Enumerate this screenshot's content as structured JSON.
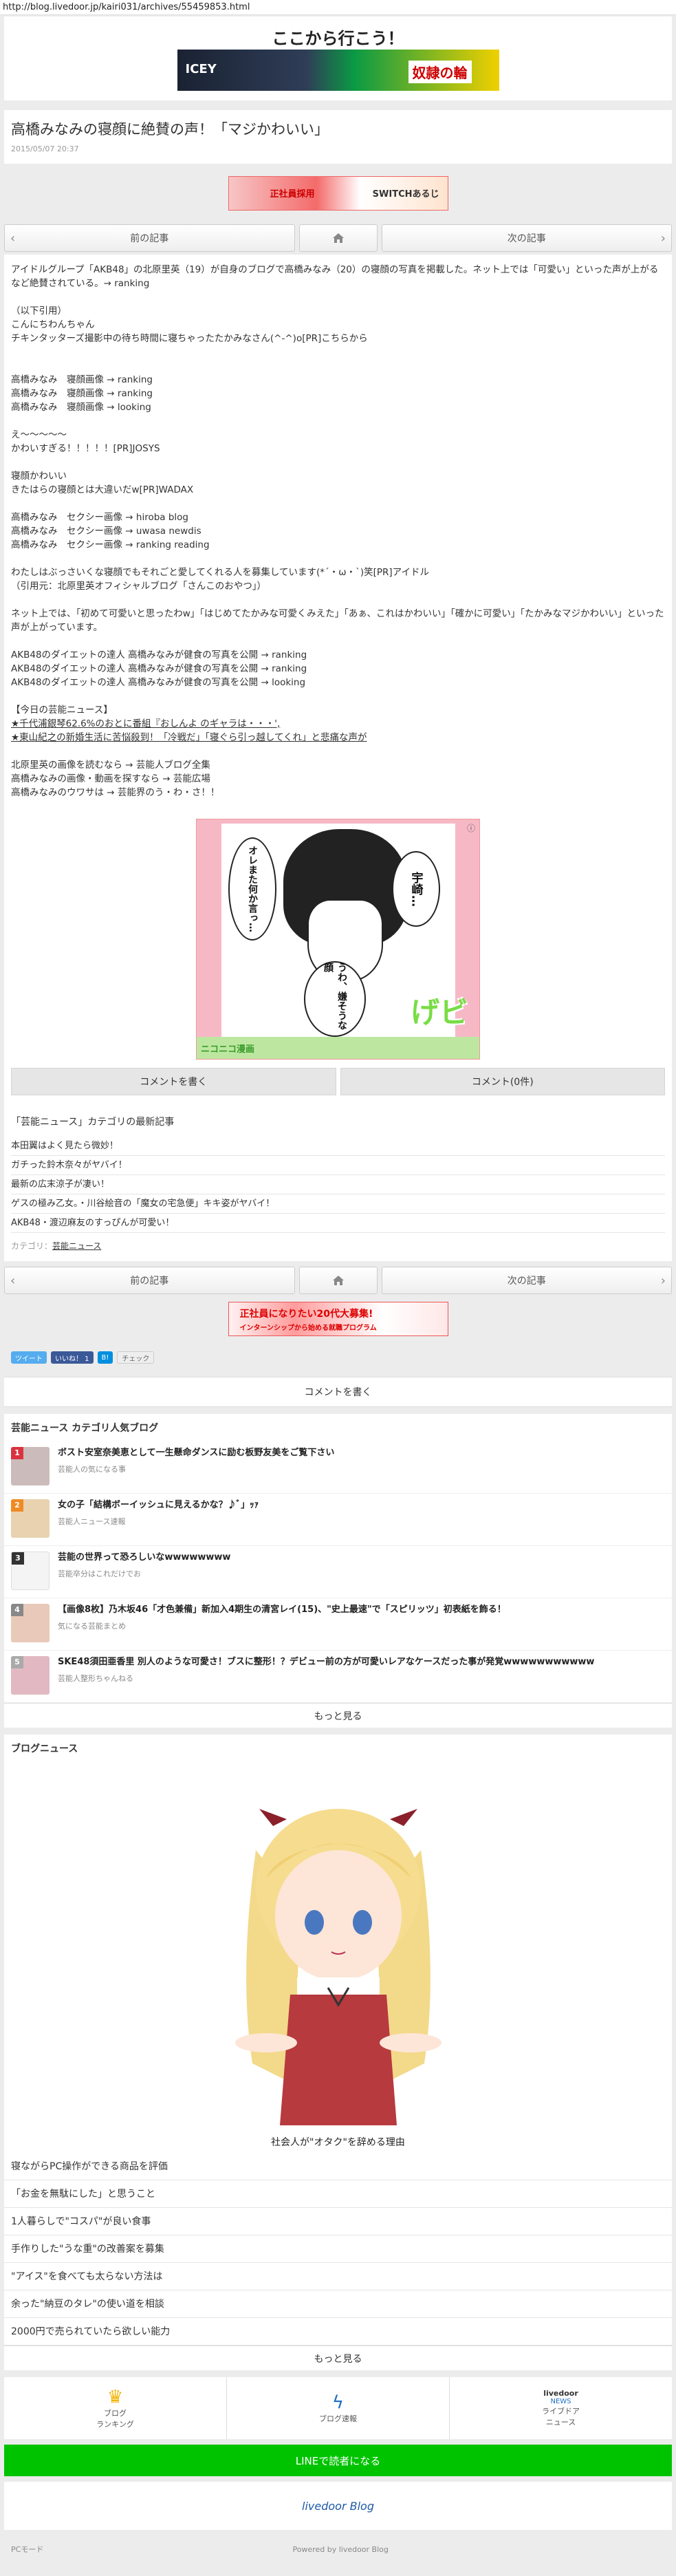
{
  "url": "http://blog.livedoor.jp/kairi031/archives/55459853.html",
  "site_title": "ここから行こう！",
  "top_banner": {
    "left": "ICEY",
    "right": "奴隷の輪"
  },
  "article": {
    "title": "高橋みなみの寝顔に絶賛の声！「マジかわいい」",
    "date": "2015/05/07 20:37"
  },
  "ad_mid": {
    "line1": "正社員採用",
    "line2": "SWITCHあるじ"
  },
  "nav": {
    "prev": "前の記事",
    "next": "次の記事",
    "home_icon": "home-icon"
  },
  "body": [
    "アイドルグループ「AKB48」の北原里英（19）が自身のブログで高橋みなみ（20）の寝顔の写真を掲載した。ネット上では「可愛い」といった声が上がるなど絶賛されている。→ ranking",
    "",
    "（以下引用）",
    "こんにちわんちゃん",
    "チキンタッターズ撮影中の待ち時間に寝ちゃったたかみなさん(^-^)o[PR]こちらから",
    "",
    "高橋みなみ　寝顔画像 → ranking",
    "高橋みなみ　寝顔画像 → ranking",
    "高橋みなみ　寝顔画像 → looking",
    "",
    "え～～～～～",
    "かわいすぎる！！！！！[PR]JOSYS",
    "",
    "寝顔かわいい",
    "きたはらの寝顔とは大違いだw[PR]WADAX",
    "",
    "高橋みなみ　セクシー画像 → hiroba blog",
    "高橋みなみ　セクシー画像 → uwasa newdis",
    "高橋みなみ　セクシー画像 → ranking reading",
    "",
    "わたしはぶっさいくな寝顔でもそれごと愛してくれる人を募集しています(*´・ω・`)笑[PR]アイドル",
    "（引用元：北原里英オフィシャルブログ「さんこのおやつ」）",
    "",
    "ネット上では、「初めて可愛いと思ったわw」「はじめてたかみな可愛くみえた」「あぁ、これはかわいい」「確かに可愛い」「たかみなマジかわいい」といった声が上がっています。",
    "",
    "AKB48のダイエットの達人 高橋みなみが健食の写真を公開 → ranking",
    "AKB48のダイエットの達人 高橋みなみが健食の写真を公開 → ranking",
    "AKB48のダイエットの達人 高橋みなみが健食の写真を公開 → looking",
    "",
    "【今日の芸能ニュース】",
    "★千代浦銀琴62.6%のおとに番組『おしんよ のギャラは・・・',",
    "★東山紀之の新婚生活に苦悩殺到！「冷戦だ」「寝ぐら引っ越してくれ」と悲痛な声が",
    "",
    "北原里英の画像を読むなら → 芸能人ブログ全集",
    "高橋みなみの画像・動画を探すなら → 芸能広場",
    "高橋みなみのウワサは → 芸能界のう・わ・さ！！"
  ],
  "manga": {
    "bubble1": "宇崎…",
    "bubble2": "オレまた何か言っ…",
    "bubble3": "うわ、嫌そうな顔",
    "logo": "ニコニコ漫画",
    "gebi": "げビ"
  },
  "comment": {
    "write": "コメントを書く",
    "count": "コメント(0件)"
  },
  "related": {
    "title": "「芸能ニュース」カテゴリの最新記事",
    "items": [
      "本田翼はよく見たら微妙！",
      "ガチった鈴木奈々がヤバイ！",
      "最新の広末涼子が凄い！",
      "ゲスの極み乙女。・川谷絵音の「魔女の宅急便」キキ姿がヤバイ！",
      "AKB48・渡辺麻友のすっぴんが可愛い！"
    ],
    "category_label": "カテゴリ：",
    "category": "芸能ニュース"
  },
  "ad_bot": {
    "line1": "正社員になりたい20代大募集!",
    "line2": "インターンシップから始める就職プログラム"
  },
  "share": {
    "tweet": "ツイート",
    "like": "いいね！ 1",
    "hatena": "B!",
    "check": "チェック"
  },
  "comment_write": "コメントを書く",
  "popular": {
    "title": "芸能ニュース カテゴリ人気ブログ",
    "items": [
      {
        "rank": "1",
        "title": "ボスト安室奈美恵として一生懸命ダンスに励む板野友美をご覧下さい",
        "blog": "芸能人の気になる事"
      },
      {
        "rank": "2",
        "title": "女の子「結構ボーイッシュに見えるかな？♪ﾞ」ｯｧ",
        "blog": "芸能人ニュース速報"
      },
      {
        "rank": "3",
        "title": "芸能の世界って恐ろしいなwwwwwwww",
        "blog": "芸能卒分はこれだけでお"
      },
      {
        "rank": "4",
        "title": "【画像8枚】乃木坂46「才色兼備」新加入4期生の清宮レイ(15)、\"史上最速\"で「スピリッツ」初表紙を飾る！",
        "blog": "気になる芸能まとめ"
      },
      {
        "rank": "5",
        "title": "SKE48須田亜香里 別人のような可愛さ！ブスに整形！？デビュー前の方が可愛いレアなケースだった事が発覚wwwwwwwwwww",
        "blog": "芸能人整形ちゃんねる"
      }
    ],
    "more": "もっと見る"
  },
  "blog_news": {
    "title": "ブログニュース",
    "caption": "社会人が\"オタク\"を辞める理由",
    "items": [
      "寝ながらPC操作ができる商品を評価",
      "「お金を無駄にした」と思うこと",
      "1人暮らしで\"コスパ\"が良い食事",
      "手作りした\"うな重\"の改善案を募集",
      "\"アイス\"を食べても太らない方法は",
      "余った\"納豆のタレ\"の使い道を相談",
      "2000円で売られていたら欲しい能力"
    ],
    "more": "もっと見る"
  },
  "footer_nav": [
    {
      "icon": "crown-icon",
      "label1": "ブログ",
      "label2": "ランキング"
    },
    {
      "icon": "lightning-icon",
      "label1": "ブログ速報",
      "label2": ""
    },
    {
      "icon": "livedoor-news-icon",
      "label1": "ライブドア",
      "label2": "ニュース",
      "brand1": "livedoor",
      "brand2": "NEWS"
    }
  ],
  "line_button": "LINEで読者になる",
  "footer_logo": "livedoor Blog",
  "bottom": {
    "pc_mode": "PCモード",
    "powered": "Powered by livedoor Blog"
  },
  "colors": {
    "line_green": "#00c300",
    "tweet": "#55acee",
    "like": "#3b5998",
    "hatena": "#008fde",
    "rank1": "#d9333f",
    "rank2": "#f08a24",
    "rank3": "#333333",
    "rank4": "#888888",
    "rank5": "#aaaaaa"
  }
}
